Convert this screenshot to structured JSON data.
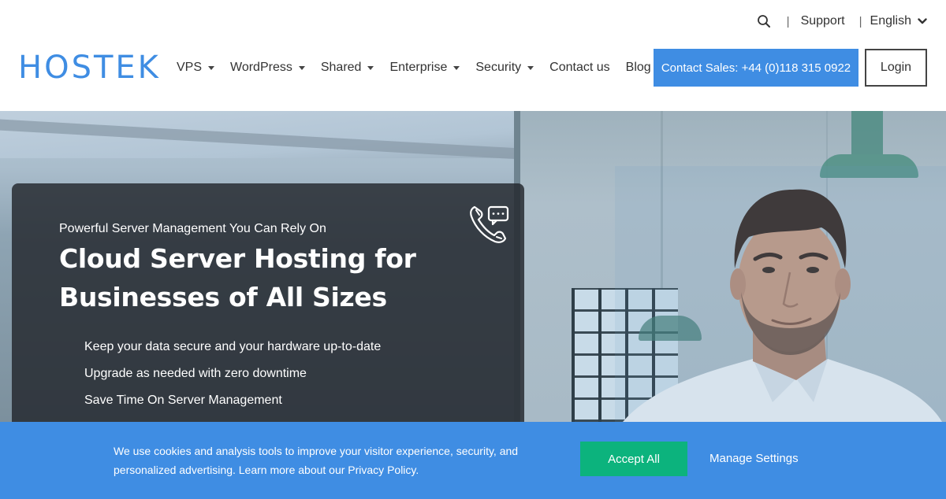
{
  "colors": {
    "brand": "#3f8de3",
    "accept": "#0cb37d",
    "text": "#333333"
  },
  "topbar": {
    "search_icon": "search-icon",
    "support": "Support",
    "language": "English"
  },
  "logo": {
    "text": "HOSTEK"
  },
  "nav": {
    "items": [
      {
        "label": "VPS",
        "dropdown": true
      },
      {
        "label": "WordPress",
        "dropdown": true
      },
      {
        "label": "Shared",
        "dropdown": true
      },
      {
        "label": "Enterprise",
        "dropdown": true
      },
      {
        "label": "Security",
        "dropdown": true
      },
      {
        "label": "Contact us",
        "dropdown": false
      },
      {
        "label": "Blog",
        "dropdown": false
      }
    ],
    "sales_button": "Contact Sales: +44 (0)118 315 0922",
    "login_button": "Login"
  },
  "hero": {
    "icon": "phone-chat-icon",
    "tagline": "Powerful Server Management You Can Rely On",
    "headline": "Cloud Server Hosting for Businesses of All Sizes",
    "features": [
      "Keep your data secure and your hardware up-to-date",
      "Upgrade as needed with zero downtime",
      "Save Time On Server Management"
    ]
  },
  "cookie": {
    "text": "We use cookies and analysis tools to improve your visitor experience, security, and personalized advertising. Learn more about our Privacy Policy.",
    "accept": "Accept All",
    "manage": "Manage Settings"
  }
}
